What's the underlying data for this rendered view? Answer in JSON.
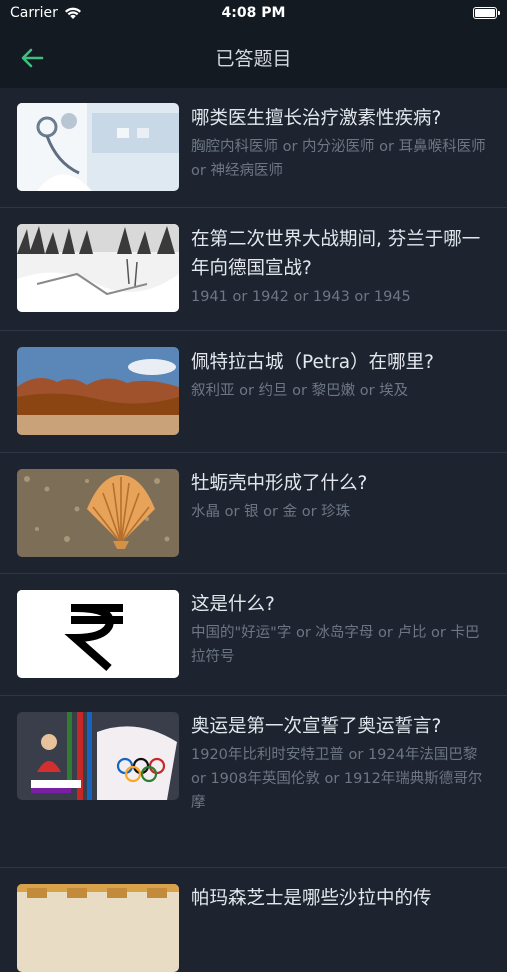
{
  "status": {
    "carrier": "Carrier",
    "time": "4:08 PM"
  },
  "nav": {
    "title": "已答题目"
  },
  "items": [
    {
      "question": "哪类医生擅长治疗激素性疾病?",
      "answers": "胸腔内科医师 or 内分泌医师 or 耳鼻喉科医师 or 神经病医师",
      "image": "doctor-stethoscope"
    },
    {
      "question": "在第二次世界大战期间, 芬兰于哪一年向德国宣战?",
      "answers": "1941 or 1942 or 1943 or 1945",
      "image": "winter-forest"
    },
    {
      "question": "佩特拉古城（Petra）在哪里?",
      "answers": "叙利亚 or 约旦 or 黎巴嫩 or 埃及",
      "image": "desert-rocks"
    },
    {
      "question": "牡蛎壳中形成了什么?",
      "answers": "水晶 or 银 or 金 or 珍珠",
      "image": "seashell-sand"
    },
    {
      "question": "这是什么?",
      "answers": "中国的\"好运\"字 or 冰岛字母 or 卢比 or 卡巴拉符号",
      "image": "rupee-symbol"
    },
    {
      "question": "奥运是第一次宣誓了奥运誓言?",
      "answers": "1920年比利时安特卫普 or 1924年法国巴黎 or 1908年英国伦敦 or 1912年瑞典斯德哥尔摩",
      "image": "olympic-flag"
    },
    {
      "question": "帕玛森芝士是哪些沙拉中的传",
      "answers": "",
      "image": "cheese-market"
    }
  ]
}
